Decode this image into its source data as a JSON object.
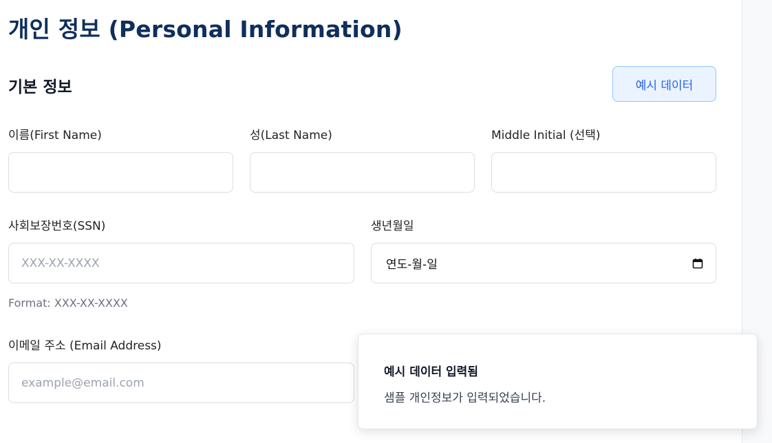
{
  "page_title": "개인 정보 (Personal Information)",
  "section_title": "기본 정보",
  "example_button_label": "예시 데이터",
  "fields": {
    "first_name": {
      "label": "이름(First Name)",
      "value": "",
      "placeholder": ""
    },
    "last_name": {
      "label": "성(Last Name)",
      "value": "",
      "placeholder": ""
    },
    "middle_initial": {
      "label": "Middle Initial (선택)",
      "value": "",
      "placeholder": ""
    },
    "ssn": {
      "label": "사회보장번호(SSN)",
      "value": "",
      "placeholder": "XXX-XX-XXXX",
      "hint": "Format: XXX-XX-XXXX"
    },
    "birthdate": {
      "label": "생년월일",
      "display": "연도-월-일",
      "icon": "calendar-icon"
    },
    "email": {
      "label": "이메일 주소 (Email Address)",
      "value": "",
      "placeholder": "example@email.com"
    }
  },
  "toast": {
    "title": "예시 데이터 입력됨",
    "description": "샘플 개인정보가 입력되었습니다."
  }
}
